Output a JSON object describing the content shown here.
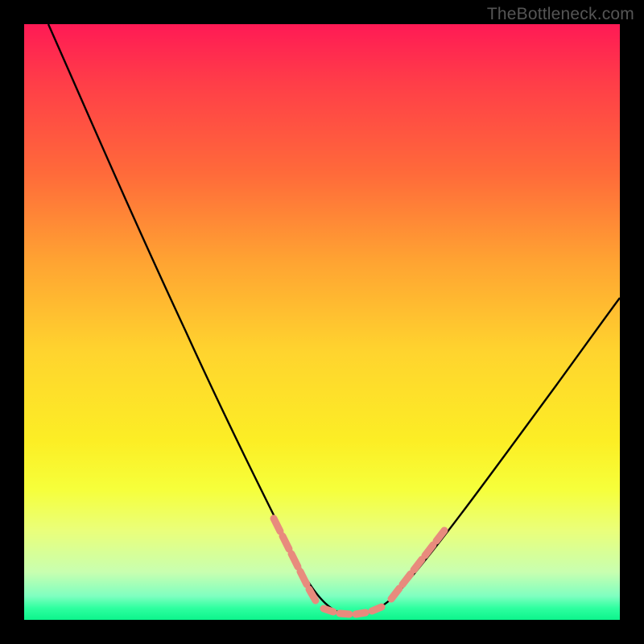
{
  "watermark": "TheBottleneck.com",
  "chart_data": {
    "type": "line",
    "title": "",
    "xlabel": "",
    "ylabel": "",
    "ylim": [
      0,
      100
    ],
    "xlim": [
      0,
      100
    ],
    "curves": [
      {
        "name": "primary-curve",
        "points": [
          {
            "x": 4,
            "y": 100
          },
          {
            "x": 12,
            "y": 82
          },
          {
            "x": 20,
            "y": 62
          },
          {
            "x": 28,
            "y": 44
          },
          {
            "x": 36,
            "y": 26
          },
          {
            "x": 42,
            "y": 12
          },
          {
            "x": 47,
            "y": 4
          },
          {
            "x": 52,
            "y": 0.7
          },
          {
            "x": 58,
            "y": 0.7
          },
          {
            "x": 63,
            "y": 4
          },
          {
            "x": 70,
            "y": 12
          },
          {
            "x": 80,
            "y": 26
          },
          {
            "x": 90,
            "y": 38
          },
          {
            "x": 100,
            "y": 46
          }
        ]
      }
    ],
    "dash_segments": {
      "left": {
        "x_from": 41,
        "x_to": 49
      },
      "floor": {
        "x_from": 49,
        "x_to": 60
      },
      "right": {
        "x_from": 60,
        "x_to": 71
      }
    },
    "colors": {
      "curve": "#000000",
      "dash": "#e88b7d",
      "gradient_top": "#ff1a55",
      "gradient_bottom": "#0cf48c"
    }
  }
}
